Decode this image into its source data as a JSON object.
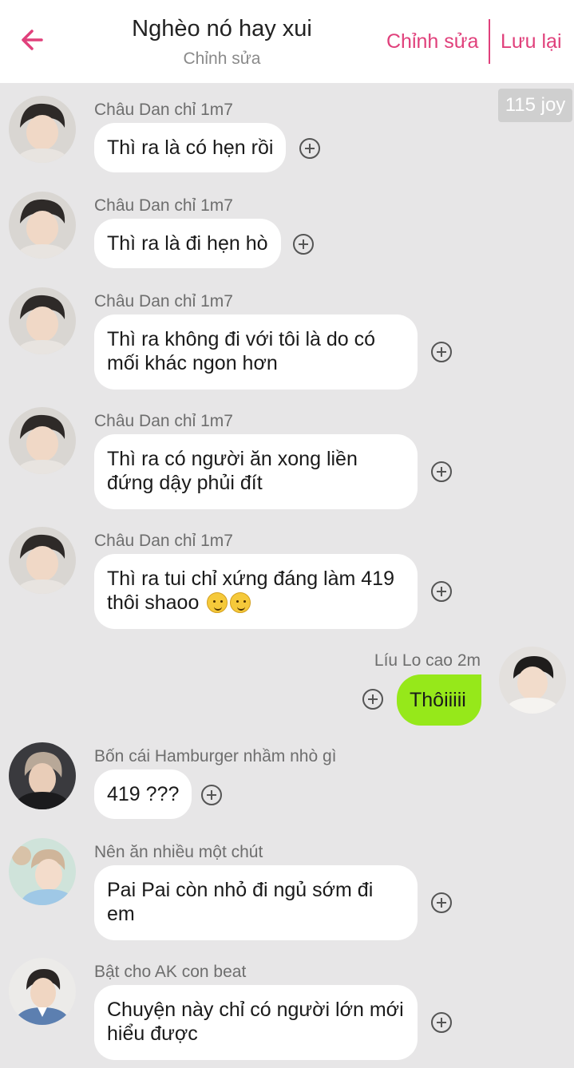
{
  "header": {
    "title": "Nghèo nó hay xui",
    "subtitle": "Chỉnh sửa",
    "edit_label": "Chỉnh sửa",
    "save_label": "Lưu lại",
    "back_icon": "arrow-left-icon"
  },
  "badge": "115 joy",
  "colors": {
    "accent": "#e0407b",
    "background": "#e7e6e7",
    "sent_bubble": "#96e81a",
    "received_bubble": "#ffffff"
  },
  "messages": [
    {
      "sender": "Châu Dan chỉ 1m7",
      "lines": [
        "Thì ra là có hẹn rồi"
      ]
    },
    {
      "sender": "Châu Dan chỉ 1m7",
      "lines": [
        "Thì ra là đi hẹn hò"
      ]
    },
    {
      "sender": "Châu Dan chỉ 1m7",
      "lines": [
        "Thì ra không đi với tôi là do có",
        "mối khác ngon hơn"
      ]
    },
    {
      "sender": "Châu Dan chỉ 1m7",
      "lines": [
        "Thì ra có người ăn xong liền",
        "đứng dậy phủi đít"
      ]
    },
    {
      "sender": "Châu Dan chỉ 1m7",
      "lines": [
        "Thì ra tui chỉ xứng đáng làm 419",
        "thôi shaoo"
      ],
      "emoji": "🥲🥲"
    },
    {
      "sender": "Líu Lo cao 2m",
      "lines": [
        "Thôiiiii"
      ],
      "outgoing": true
    },
    {
      "sender": "Bốn cái Hamburger nhầm nhò gì",
      "lines": [
        "419 ???"
      ]
    },
    {
      "sender": "Nên ăn nhiều một chút",
      "lines": [
        "Pai Pai còn nhỏ đi ngủ sớm đi",
        "em"
      ]
    },
    {
      "sender": "Bật cho AK con beat",
      "lines": [
        "Chuyện này chỉ có người lớn mới",
        "hiểu được"
      ]
    }
  ]
}
